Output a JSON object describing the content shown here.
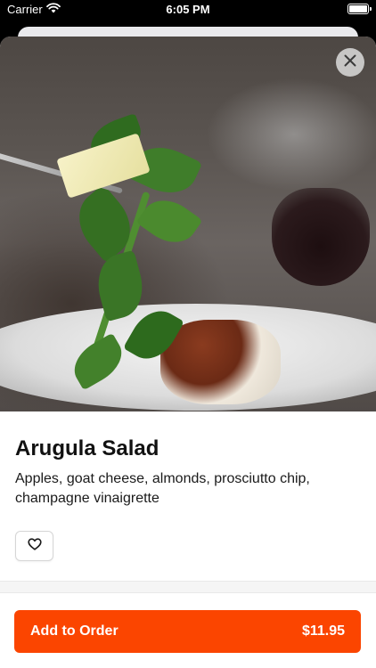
{
  "status_bar": {
    "carrier": "Carrier",
    "time": "6:05 PM"
  },
  "item": {
    "name": "Arugula Salad",
    "description": "Apples, goat cheese, almonds, prosciutto chip, champagne vinaigrette"
  },
  "order_button": {
    "label": "Add to Order",
    "price": "$11.95"
  },
  "colors": {
    "accent": "#fb4500"
  },
  "icons": {
    "close": "close-icon",
    "favorite": "heart-outline-icon",
    "wifi": "wifi-icon",
    "battery": "battery-icon"
  }
}
